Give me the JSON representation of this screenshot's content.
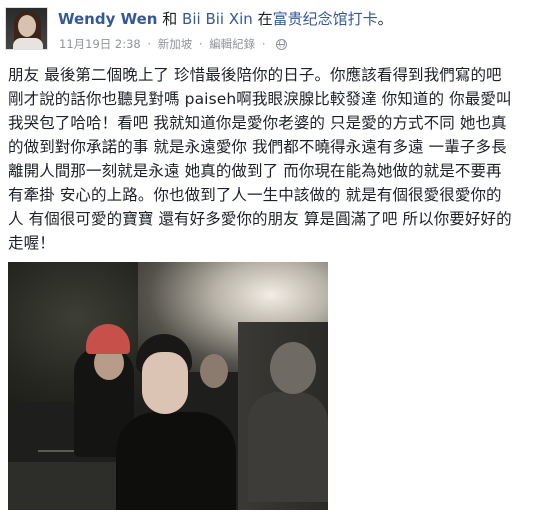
{
  "post": {
    "author": "Wendy Wen",
    "joiner": "和",
    "tagged": "Bii Bii Xin",
    "action": "在",
    "place": "富贵纪念馆打卡",
    "place_suffix": "。",
    "timestamp": "11月19日 2:38",
    "location": "新加坡",
    "edit_history": "編輯紀錄",
    "separator": "·",
    "privacy_icon": "globe-icon",
    "text_lines": [
      "朋友 最後第二個晚上了 珍惜最後陪你的日子。你應該看得到我們寫的吧",
      "剛才說的話你也聽見對嗎 paiseh啊我眼淚腺比較發達 你知道的 你最愛叫",
      "我哭包了哈哈！看吧 我就知道你是愛你老婆的 只是愛的方式不同 她也真",
      "的做到對你承諾的事 就是永遠愛你 我們都不曉得永遠有多遠 一輩子多長",
      "離開人間那一刻就是永遠 她真的做到了 而你現在能為她做的就是不要再",
      "有牽掛 安心的上路。你也做到了人一生中該做的 就是有個很愛很愛你的",
      "人 有個很可愛的寶寶 還有好多愛你的朋友 算是圓滿了吧 所以你要好好的",
      "走喔！"
    ]
  },
  "colors": {
    "link": "#365899",
    "text": "#1d2129",
    "meta": "#90949c"
  }
}
